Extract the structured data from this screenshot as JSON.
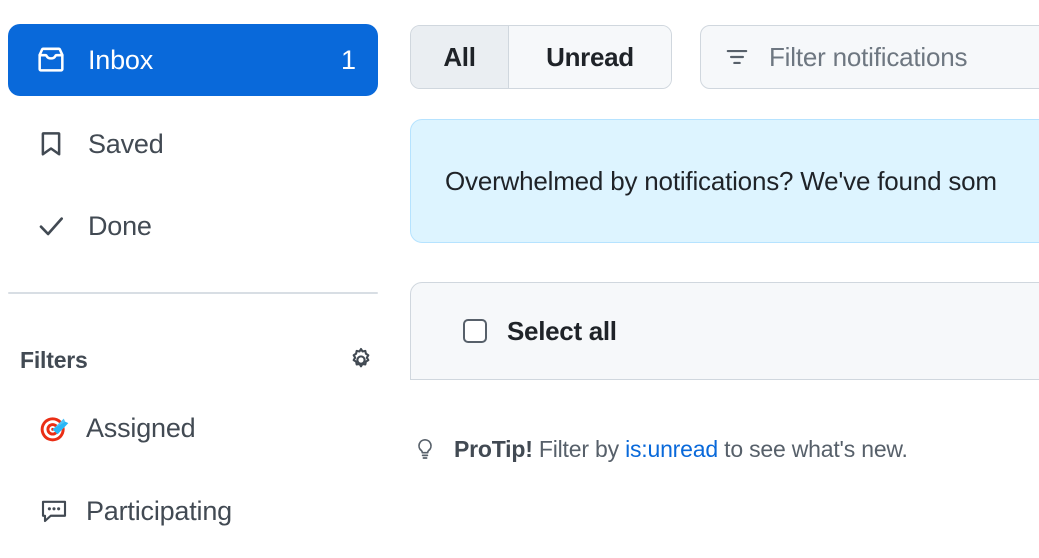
{
  "sidebar": {
    "nav": [
      {
        "id": "inbox",
        "label": "Inbox",
        "icon": "inbox-icon",
        "count": "1",
        "selected": true
      },
      {
        "id": "saved",
        "label": "Saved",
        "icon": "bookmark-icon",
        "count": "",
        "selected": false
      },
      {
        "id": "done",
        "label": "Done",
        "icon": "check-icon",
        "count": "",
        "selected": false
      }
    ],
    "filters_section": {
      "title": "Filters",
      "settings_icon": "gear-icon",
      "items": [
        {
          "id": "assigned",
          "label": "Assigned",
          "icon": "target-icon"
        },
        {
          "id": "participating",
          "label": "Participating",
          "icon": "comment-discussion-icon"
        }
      ]
    }
  },
  "main": {
    "tabs": [
      {
        "id": "all",
        "label": "All",
        "active": true
      },
      {
        "id": "unread",
        "label": "Unread",
        "active": false
      }
    ],
    "filter_input": {
      "icon": "filter-icon",
      "placeholder": "Filter notifications",
      "value": ""
    },
    "banner": {
      "text": "Overwhelmed by notifications? We've found som"
    },
    "select_all": {
      "label": "Select all",
      "checked": false
    },
    "protip": {
      "icon": "light-bulb-icon",
      "label": "ProTip!",
      "text_before": "Filter by",
      "link": "is:unread",
      "text_after": "to see what's new."
    }
  },
  "colors": {
    "accent_blue": "#0969da",
    "banner_bg": "#ddf4ff",
    "banner_border": "#b6e3ff",
    "surface_gray": "#f6f8fa",
    "tab_active_gray": "#eaeef2",
    "border_gray": "#d0d7de",
    "text_primary": "#1f2328",
    "text_muted": "#57606a"
  }
}
